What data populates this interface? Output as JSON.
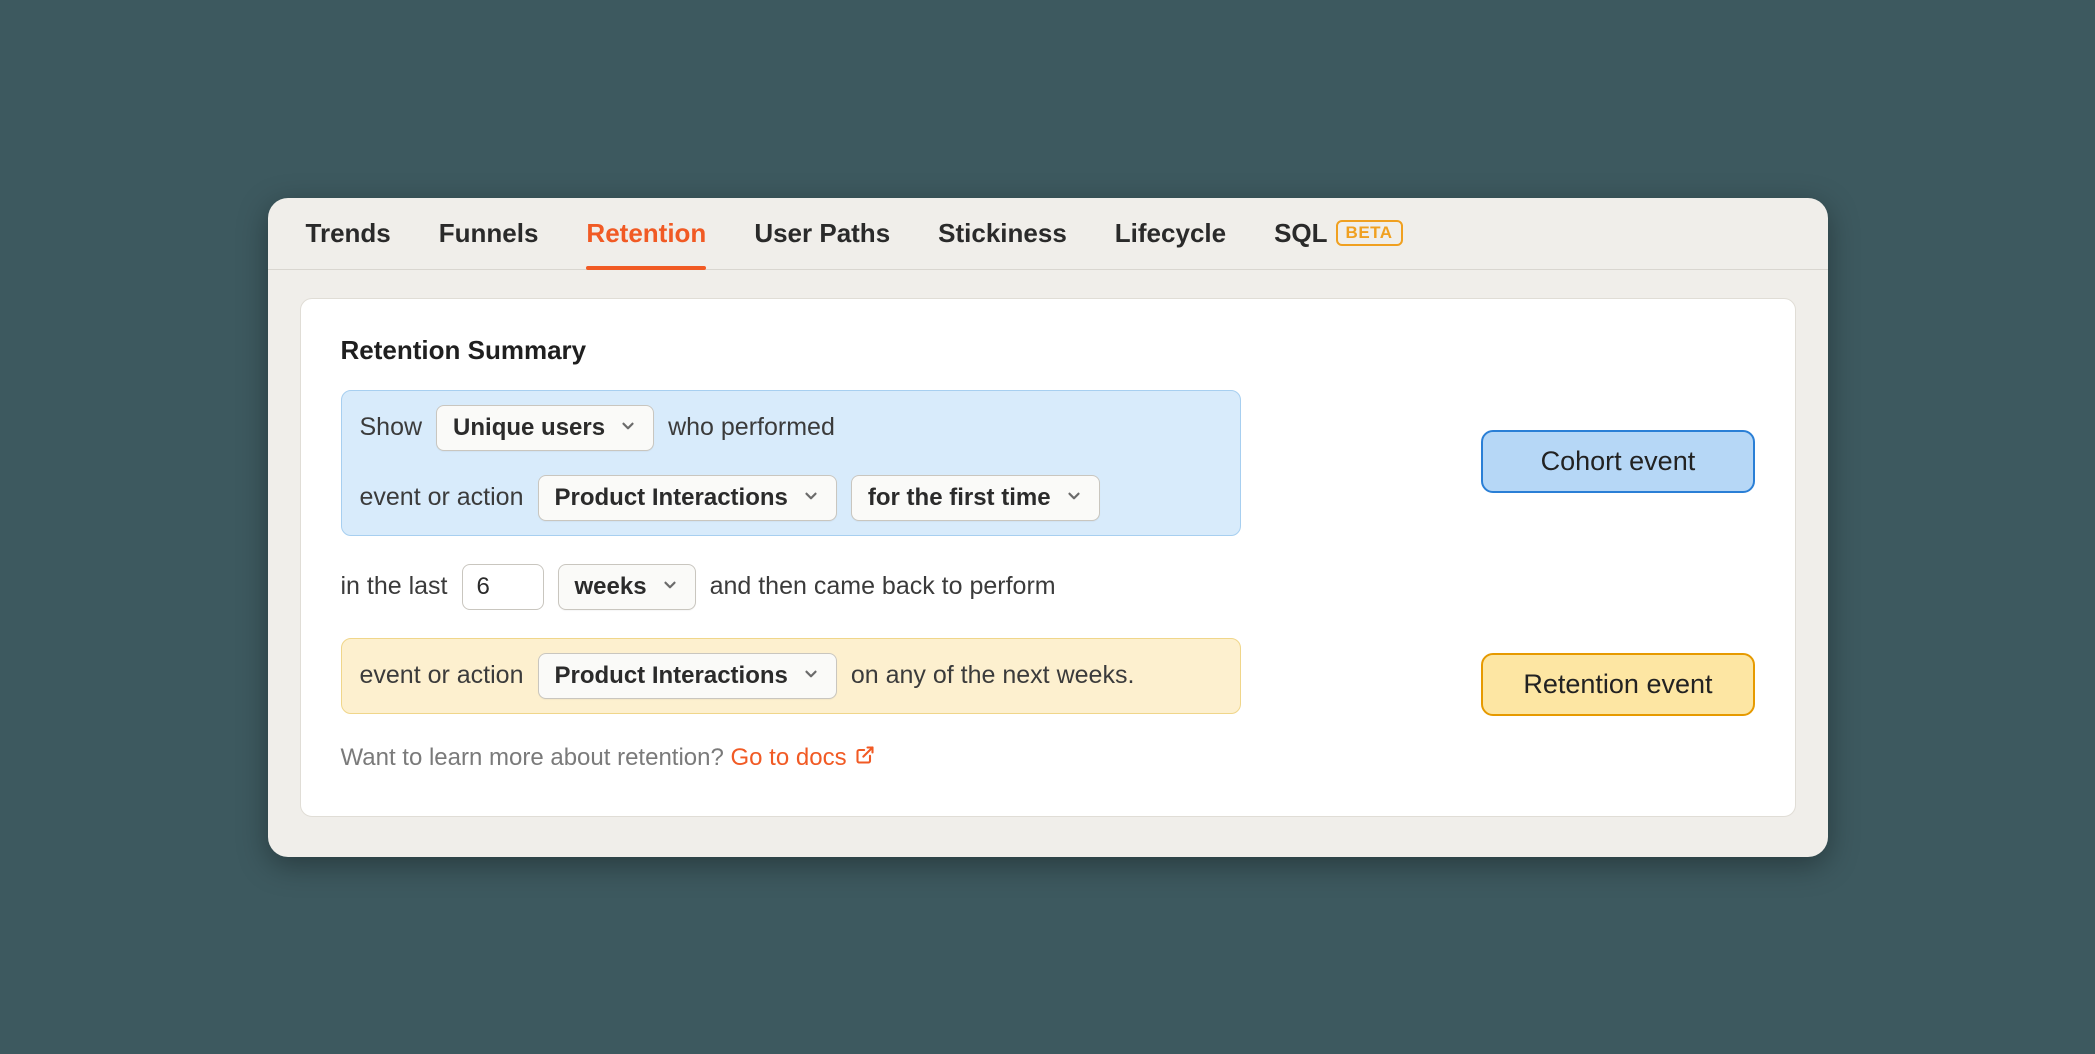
{
  "tabs": {
    "trends": "Trends",
    "funnels": "Funnels",
    "retention": "Retention",
    "user_paths": "User Paths",
    "stickiness": "Stickiness",
    "lifecycle": "Lifecycle",
    "sql": "SQL",
    "beta_badge": "BETA"
  },
  "card": {
    "title": "Retention Summary"
  },
  "cohort": {
    "show": "Show",
    "unique_users": "Unique users",
    "who_performed": "who performed",
    "event_or_action": "event or action",
    "event_select": "Product Interactions",
    "condition_select": "for the first time"
  },
  "period": {
    "in_the_last": "in the last",
    "value": "6",
    "unit": "weeks",
    "and_then": "and then came back to perform"
  },
  "retention": {
    "event_or_action": "event or action",
    "event_select": "Product Interactions",
    "on_any": "on any of the next weeks."
  },
  "docs": {
    "prompt": "Want to learn more about retention? ",
    "link": "Go to docs"
  },
  "legend": {
    "cohort": "Cohort event",
    "retention": "Retention event"
  }
}
